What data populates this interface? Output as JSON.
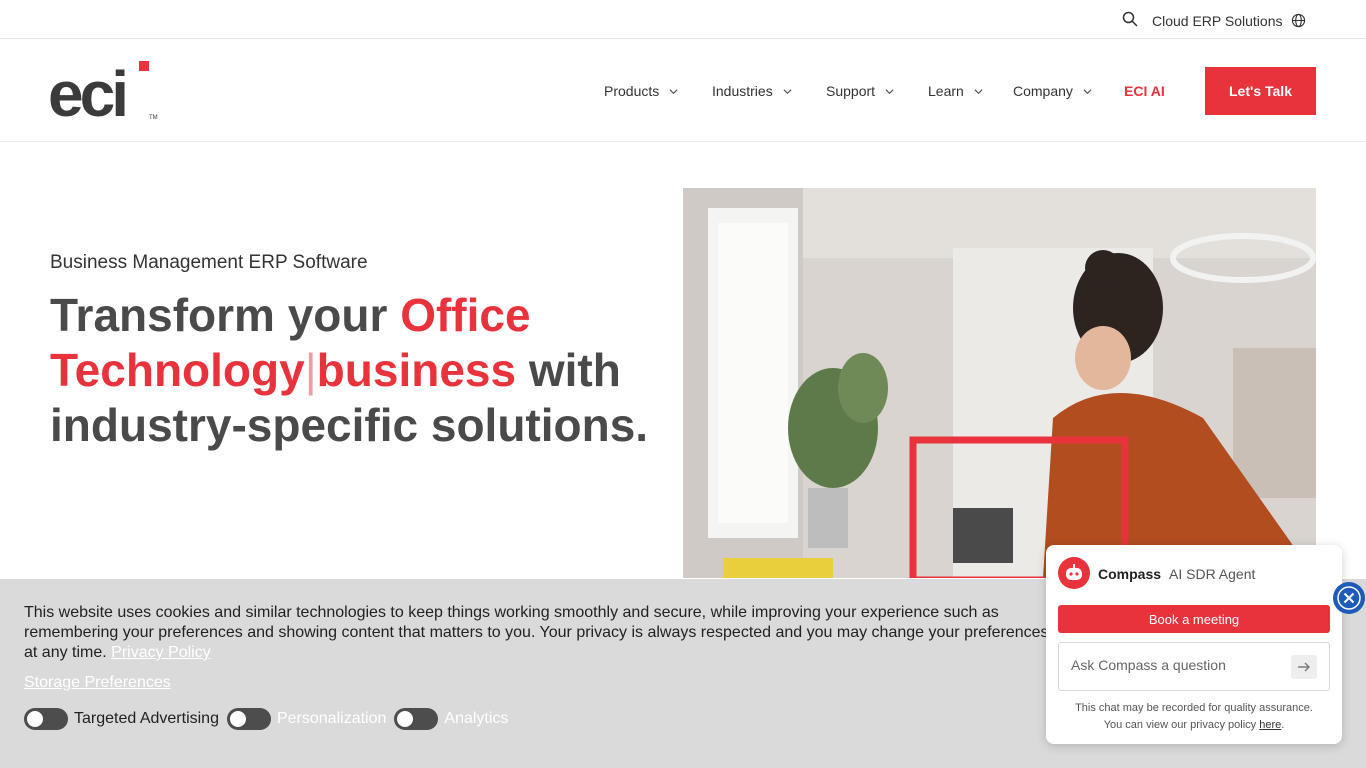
{
  "topbar": {
    "search_icon": "search-icon",
    "cloud_label": "Cloud ERP Solutions",
    "globe_icon": "globe-icon"
  },
  "nav": {
    "logo_text": "eci",
    "logo_mark": "TM",
    "items": [
      {
        "label": "Products"
      },
      {
        "label": "Industries"
      },
      {
        "label": "Support"
      },
      {
        "label": "Learn"
      },
      {
        "label": "Company"
      }
    ],
    "eci_ai": "ECI AI",
    "cta": "Let's Talk"
  },
  "hero": {
    "eyebrow": "Business Management ERP Software",
    "headline_part1": "Transform your ",
    "headline_red1": "Office Technology",
    "headline_cursor": "|",
    "headline_red2": "business",
    "headline_part2": " with industry-specific solutions."
  },
  "cookie": {
    "text": "This website uses cookies and similar technologies to keep things working smoothly and secure, while improving your experience such as remembering your preferences and showing content that matters to you. Your privacy is always respected and you may change your preferences at any time. ",
    "privacy_link": "Privacy Policy",
    "storage_link": "Storage Preferences",
    "toggles": [
      {
        "label": "Targeted Advertising",
        "color": "#222222"
      },
      {
        "label": "Personalization",
        "color": "#ffffff"
      },
      {
        "label": "Analytics",
        "color": "#ffffff"
      }
    ]
  },
  "chat": {
    "name": "Compass",
    "role": "AI SDR Agent",
    "book": "Book a meeting",
    "placeholder": "Ask Compass a question",
    "note_line1": "This chat may be recorded for quality assurance.",
    "note_line2": "You can view our privacy policy ",
    "note_link": "here",
    "note_end": "."
  },
  "colors": {
    "brand_red": "#e8323c",
    "close_blue": "#1e5bb8"
  }
}
